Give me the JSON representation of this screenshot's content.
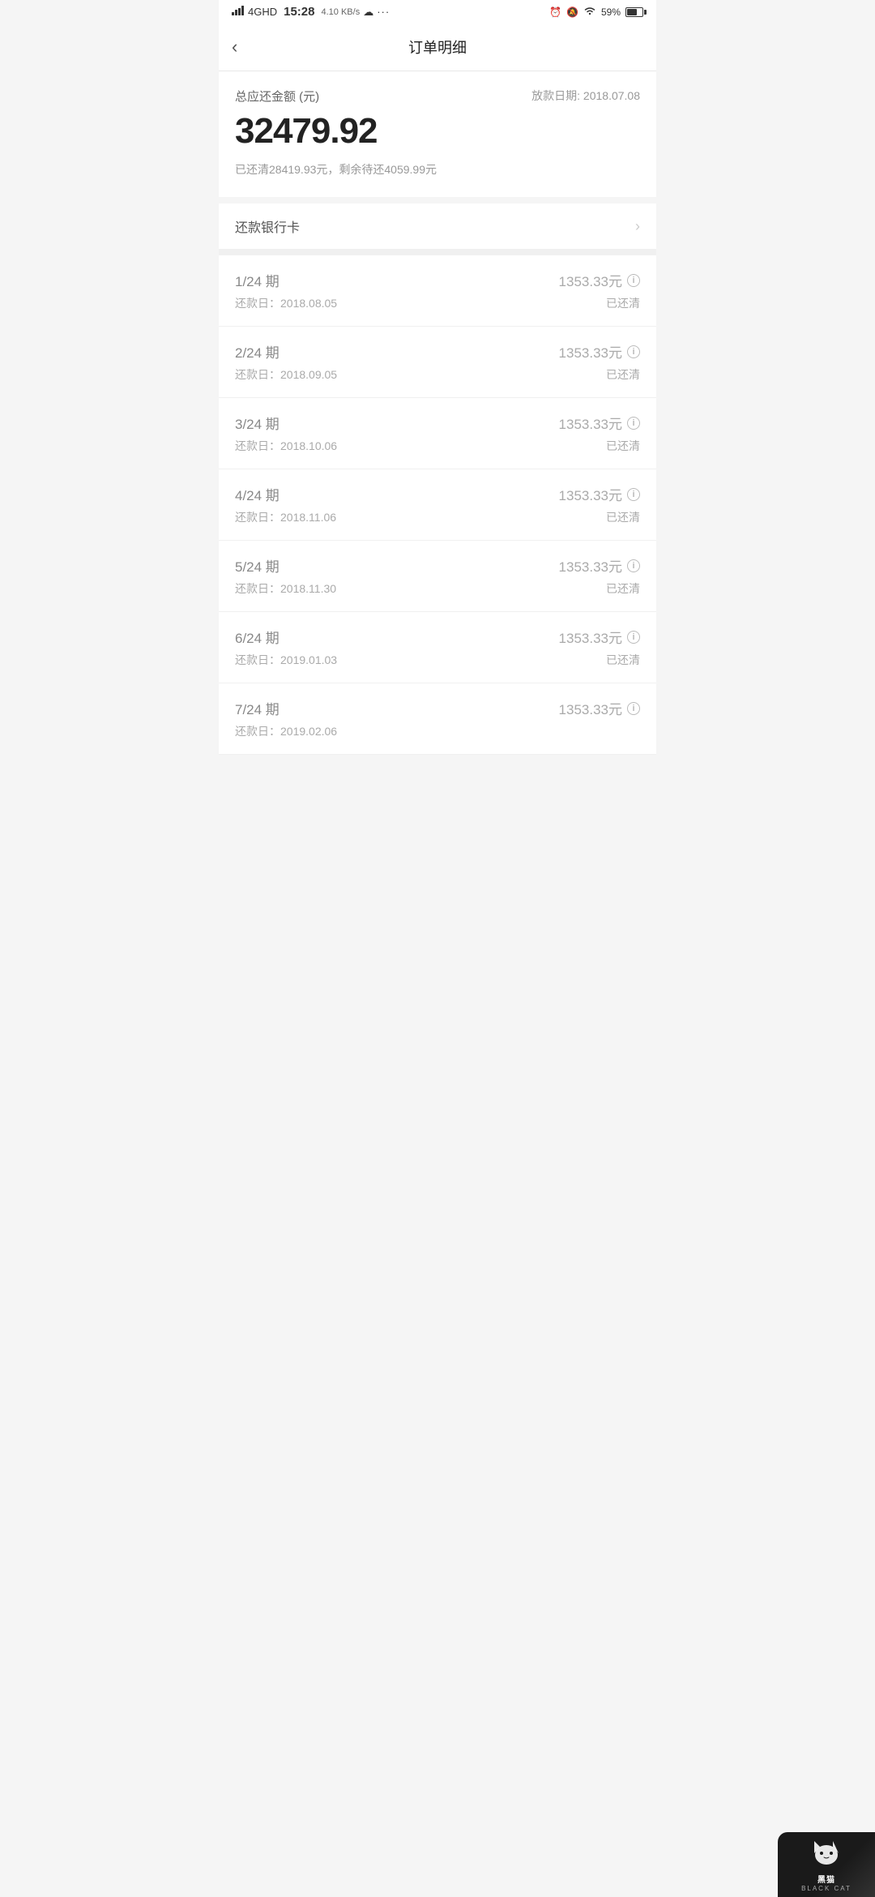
{
  "statusBar": {
    "signal": "4GHD",
    "time": "15:28",
    "network": "4.10 KB/s",
    "battery": "59%"
  },
  "header": {
    "back_label": "‹",
    "title": "订单明细"
  },
  "summary": {
    "label": "总应还金额 (元)",
    "date_label": "放款日期: 2018.07.08",
    "amount": "32479.92",
    "detail": "已还清28419.93元，剩余待还4059.99元"
  },
  "bankCard": {
    "label": "还款银行卡"
  },
  "installments": [
    {
      "period": "1/24 期",
      "due_date_label": "还款日：2018.08.05",
      "amount": "1353.33元",
      "status": "已还清"
    },
    {
      "period": "2/24 期",
      "due_date_label": "还款日：2018.09.05",
      "amount": "1353.33元",
      "status": "已还清"
    },
    {
      "period": "3/24 期",
      "due_date_label": "还款日：2018.10.06",
      "amount": "1353.33元",
      "status": "已还清"
    },
    {
      "period": "4/24 期",
      "due_date_label": "还款日：2018.11.06",
      "amount": "1353.33元",
      "status": "已还清"
    },
    {
      "period": "5/24 期",
      "due_date_label": "还款日：2018.11.30",
      "amount": "1353.33元",
      "status": "已还清"
    },
    {
      "period": "6/24 期",
      "due_date_label": "还款日：2019.01.03",
      "amount": "1353.33元",
      "status": "已还清"
    },
    {
      "period": "7/24 期",
      "due_date_label": "还款日：2019.02.06",
      "amount": "1353.33元",
      "status": ""
    }
  ],
  "watermark": {
    "icon": "🐱",
    "main_text": "黑猫",
    "sub_text": "BLACK CAT"
  }
}
